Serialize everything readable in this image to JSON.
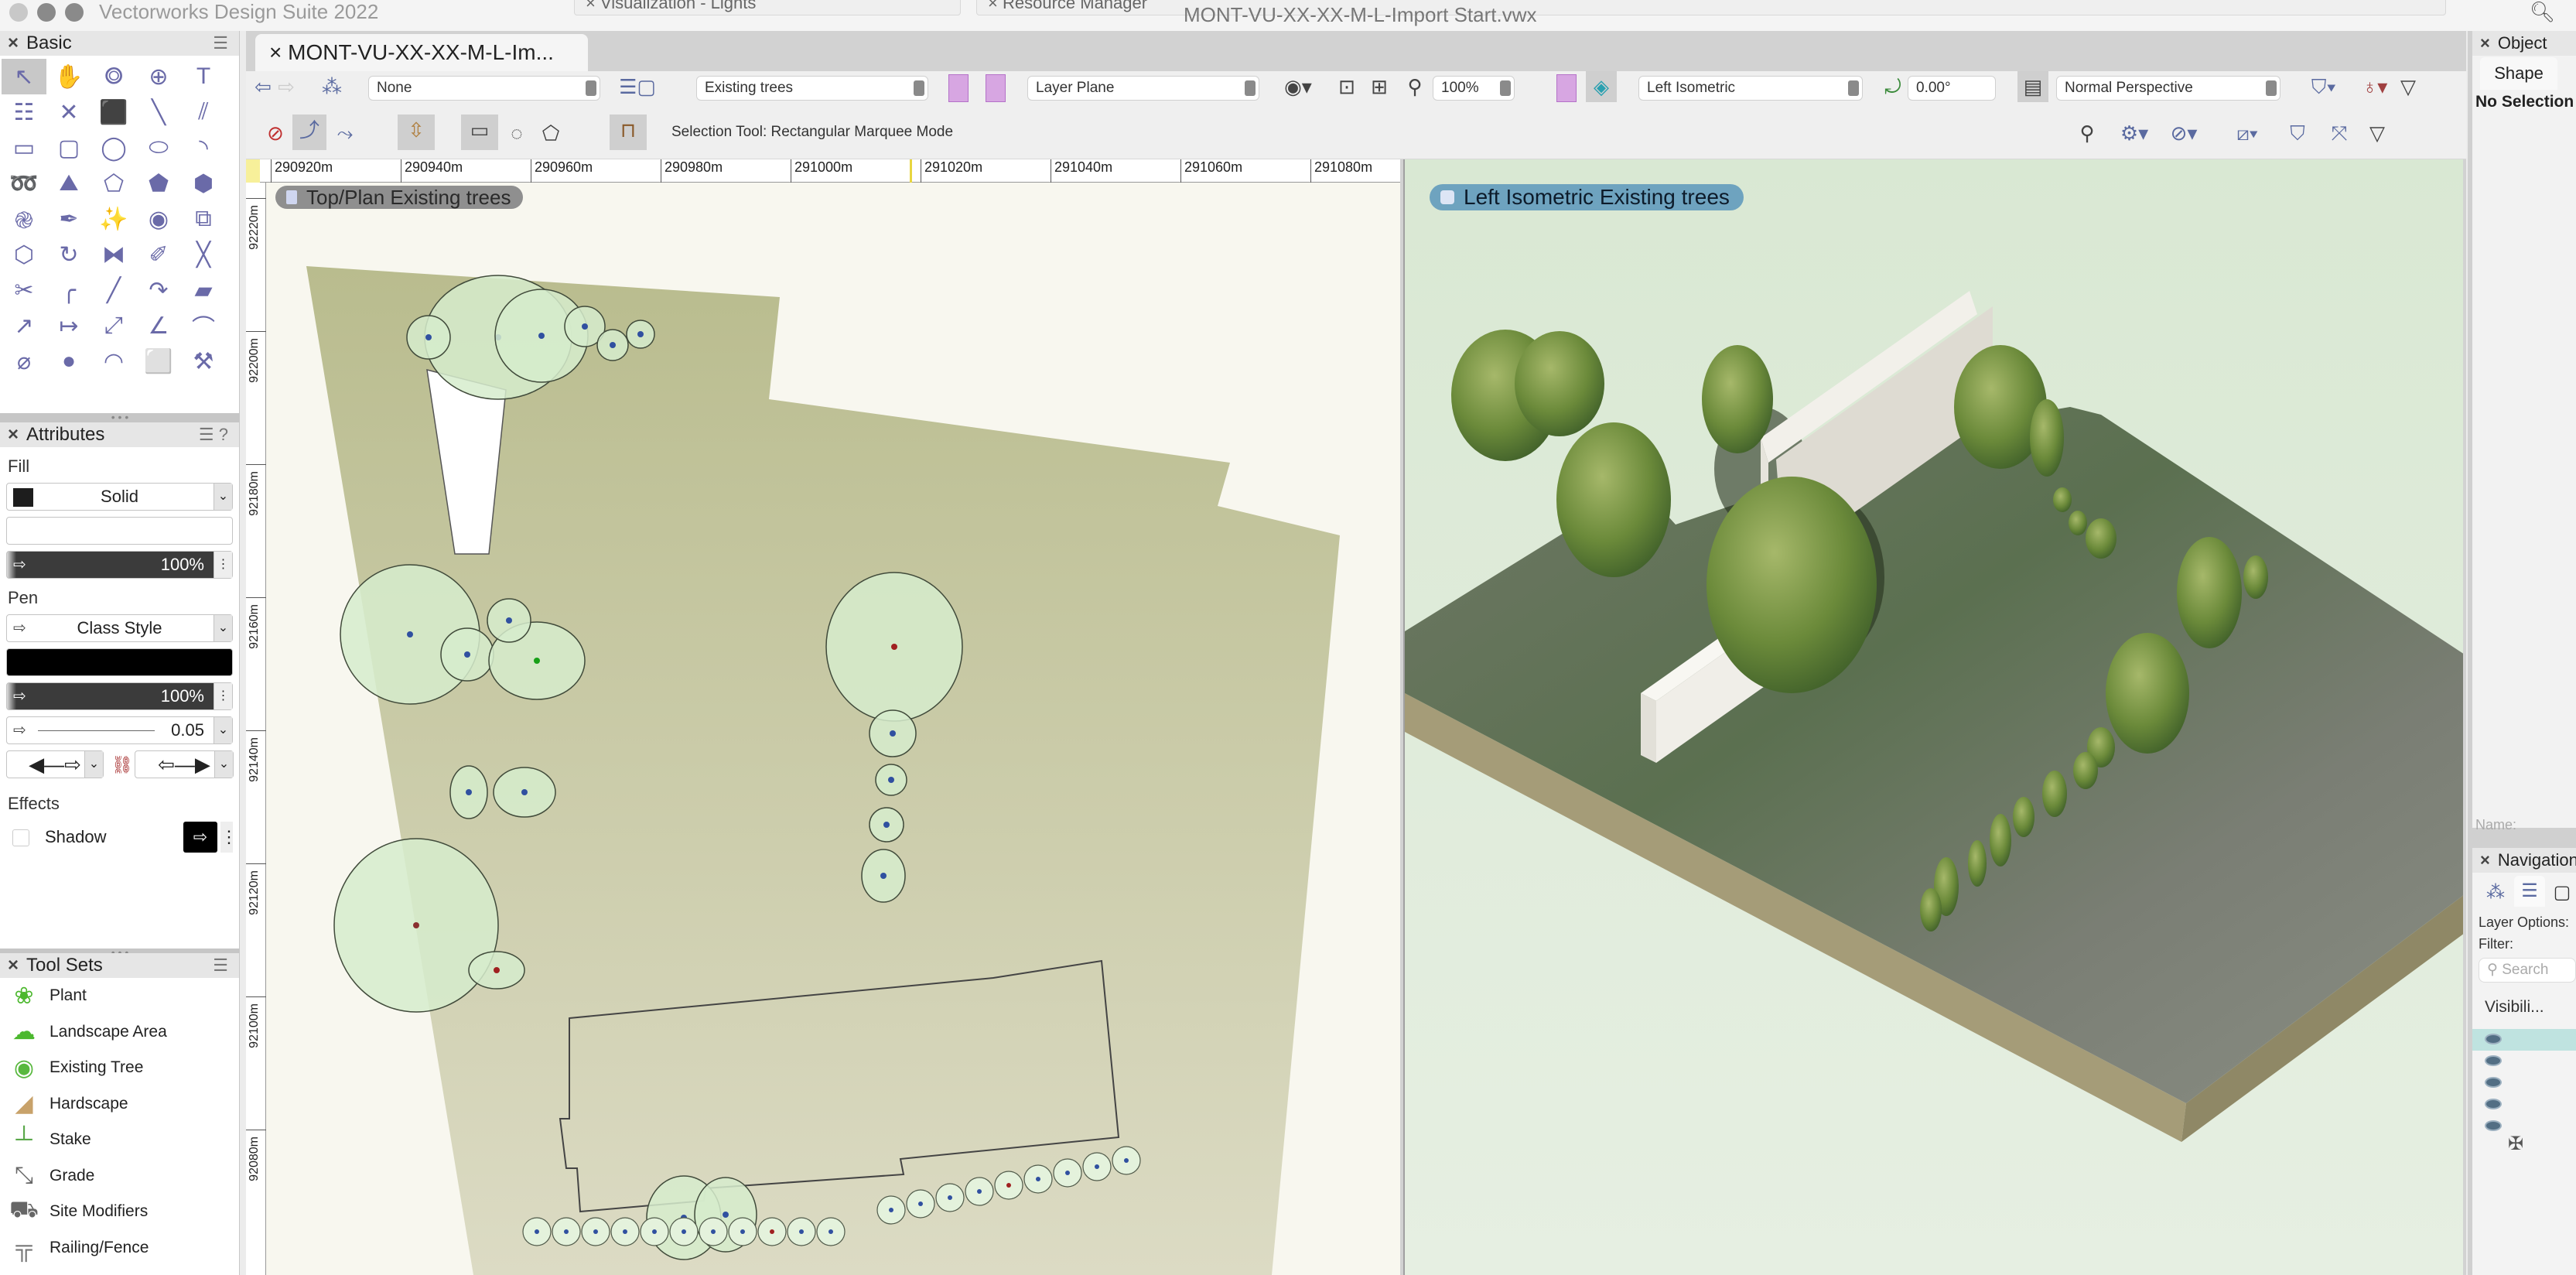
{
  "window": {
    "app_title": "Vectorworks Design Suite 2022",
    "floating_palettes": [
      "Visualization - Lights",
      "Resource Manager"
    ],
    "document_title": "MONT-VU-XX-XX-M-L-Import Start.vwx"
  },
  "basic_palette": {
    "title": "Basic",
    "tools": [
      {
        "name": "selection",
        "glyph": "↖"
      },
      {
        "name": "pan",
        "glyph": "✋"
      },
      {
        "name": "flyover",
        "glyph": "⭗"
      },
      {
        "name": "zoom",
        "glyph": "⊕"
      },
      {
        "name": "text",
        "glyph": "T"
      },
      {
        "name": "callout",
        "glyph": "☷"
      },
      {
        "name": "locus",
        "glyph": "✕"
      },
      {
        "name": "3d-locus",
        "glyph": "⬛"
      },
      {
        "name": "line",
        "glyph": "╲"
      },
      {
        "name": "double-line",
        "glyph": "⫽"
      },
      {
        "name": "rectangle",
        "glyph": "▭"
      },
      {
        "name": "rounded-rectangle",
        "glyph": "▢"
      },
      {
        "name": "circle",
        "glyph": "◯"
      },
      {
        "name": "oval",
        "glyph": "⬭"
      },
      {
        "name": "arc",
        "glyph": "◝"
      },
      {
        "name": "freehand",
        "glyph": "➿"
      },
      {
        "name": "polyline",
        "glyph": "⛰"
      },
      {
        "name": "polygon",
        "glyph": "⬠"
      },
      {
        "name": "double-line-polygon",
        "glyph": "⬟"
      },
      {
        "name": "regular-polygon",
        "glyph": "⬢"
      },
      {
        "name": "spiral",
        "glyph": "֎"
      },
      {
        "name": "eyedropper",
        "glyph": "✒"
      },
      {
        "name": "magic-wand",
        "glyph": "✨"
      },
      {
        "name": "visibility",
        "glyph": "◉"
      },
      {
        "name": "clip",
        "glyph": "⧉"
      },
      {
        "name": "reshape",
        "glyph": "⬡"
      },
      {
        "name": "rotate",
        "glyph": "↻"
      },
      {
        "name": "mirror",
        "glyph": "⧓"
      },
      {
        "name": "split",
        "glyph": "✐"
      },
      {
        "name": "trim",
        "glyph": "╳"
      },
      {
        "name": "scissors",
        "glyph": "✂"
      },
      {
        "name": "fillet",
        "glyph": "╭"
      },
      {
        "name": "chamfer",
        "glyph": "╱"
      },
      {
        "name": "offset",
        "glyph": "↷"
      },
      {
        "name": "eraser",
        "glyph": "▰"
      },
      {
        "name": "connect",
        "glyph": "↗"
      },
      {
        "name": "dimension",
        "glyph": "↦"
      },
      {
        "name": "angle-dimension",
        "glyph": "⤢"
      },
      {
        "name": "arc-length-dimension",
        "glyph": "∠"
      },
      {
        "name": "chain-dimension",
        "glyph": "⌒"
      },
      {
        "name": "diameter-dimension",
        "glyph": "⌀"
      },
      {
        "name": "tape-measure",
        "glyph": "●"
      },
      {
        "name": "protractor",
        "glyph": "◠"
      },
      {
        "name": "stretch",
        "glyph": "⬜"
      },
      {
        "name": "attribute-mapping",
        "glyph": "⚒"
      }
    ]
  },
  "attributes": {
    "title": "Attributes",
    "fill_label": "Fill",
    "fill_style": "Solid",
    "fill_opacity": "100%",
    "pen_label": "Pen",
    "pen_style": "Class Style",
    "pen_opacity": "100%",
    "line_thickness": "0.05",
    "effects_label": "Effects",
    "shadow_label": "Shadow",
    "shadow_checked": false,
    "colors": {
      "fill_swatch": "#1d1d1d",
      "pen_color": "#000000"
    }
  },
  "tool_sets": {
    "title": "Tool Sets",
    "items": [
      {
        "label": "Plant",
        "icon": "plant-icon",
        "glyph": "❀",
        "color": "#4cb82e"
      },
      {
        "label": "Landscape Area",
        "icon": "landscape-area-icon",
        "glyph": "☁",
        "color": "#4cb82e"
      },
      {
        "label": "Existing Tree",
        "icon": "existing-tree-icon",
        "glyph": "◉",
        "color": "#58b83e"
      },
      {
        "label": "Hardscape",
        "icon": "hardscape-icon",
        "glyph": "◢",
        "color": "#c8a26a"
      },
      {
        "label": "Stake",
        "icon": "stake-icon",
        "glyph": "┴",
        "color": "#5aa84a"
      },
      {
        "label": "Grade",
        "icon": "grade-icon",
        "glyph": "⤡",
        "color": "#666666"
      },
      {
        "label": "Site Modifiers",
        "icon": "site-modifiers-icon",
        "glyph": "⛟",
        "color": "#666666"
      },
      {
        "label": "Railing/Fence",
        "icon": "railing-fence-icon",
        "glyph": "╦",
        "color": "#777777"
      }
    ]
  },
  "document": {
    "tab_label": "MONT-VU-XX-XX-M-L-Im...",
    "view_bar": {
      "class": "None",
      "layer": "Existing trees",
      "working_plane": "Layer Plane",
      "zoom": "100%",
      "view": "Left Isometric",
      "rotation": "0.00°",
      "projection": "Normal Perspective"
    },
    "tool_mode_text": "Selection Tool: Rectangular Marquee Mode",
    "ruler_h": [
      "290920m",
      "290940m",
      "290960m",
      "290980m",
      "291000m",
      "291020m",
      "291040m",
      "291060m",
      "291080m"
    ],
    "ruler_v": [
      "92220m",
      "92200m",
      "92180m",
      "92160m",
      "92140m",
      "92120m",
      "92100m",
      "92080m"
    ],
    "plan_view_label": "Top/Plan  Existing trees",
    "iso_view_label": "Left Isometric  Existing trees"
  },
  "object_info": {
    "title": "Object Info",
    "tab": "Shape",
    "selection": "No Selection",
    "name_label": "Name:"
  },
  "navigation": {
    "title": "Navigation",
    "layer_options_label": "Layer Options:",
    "filter_label": "Filter:",
    "search_placeholder": "Search",
    "column_header": "Visibili..."
  }
}
